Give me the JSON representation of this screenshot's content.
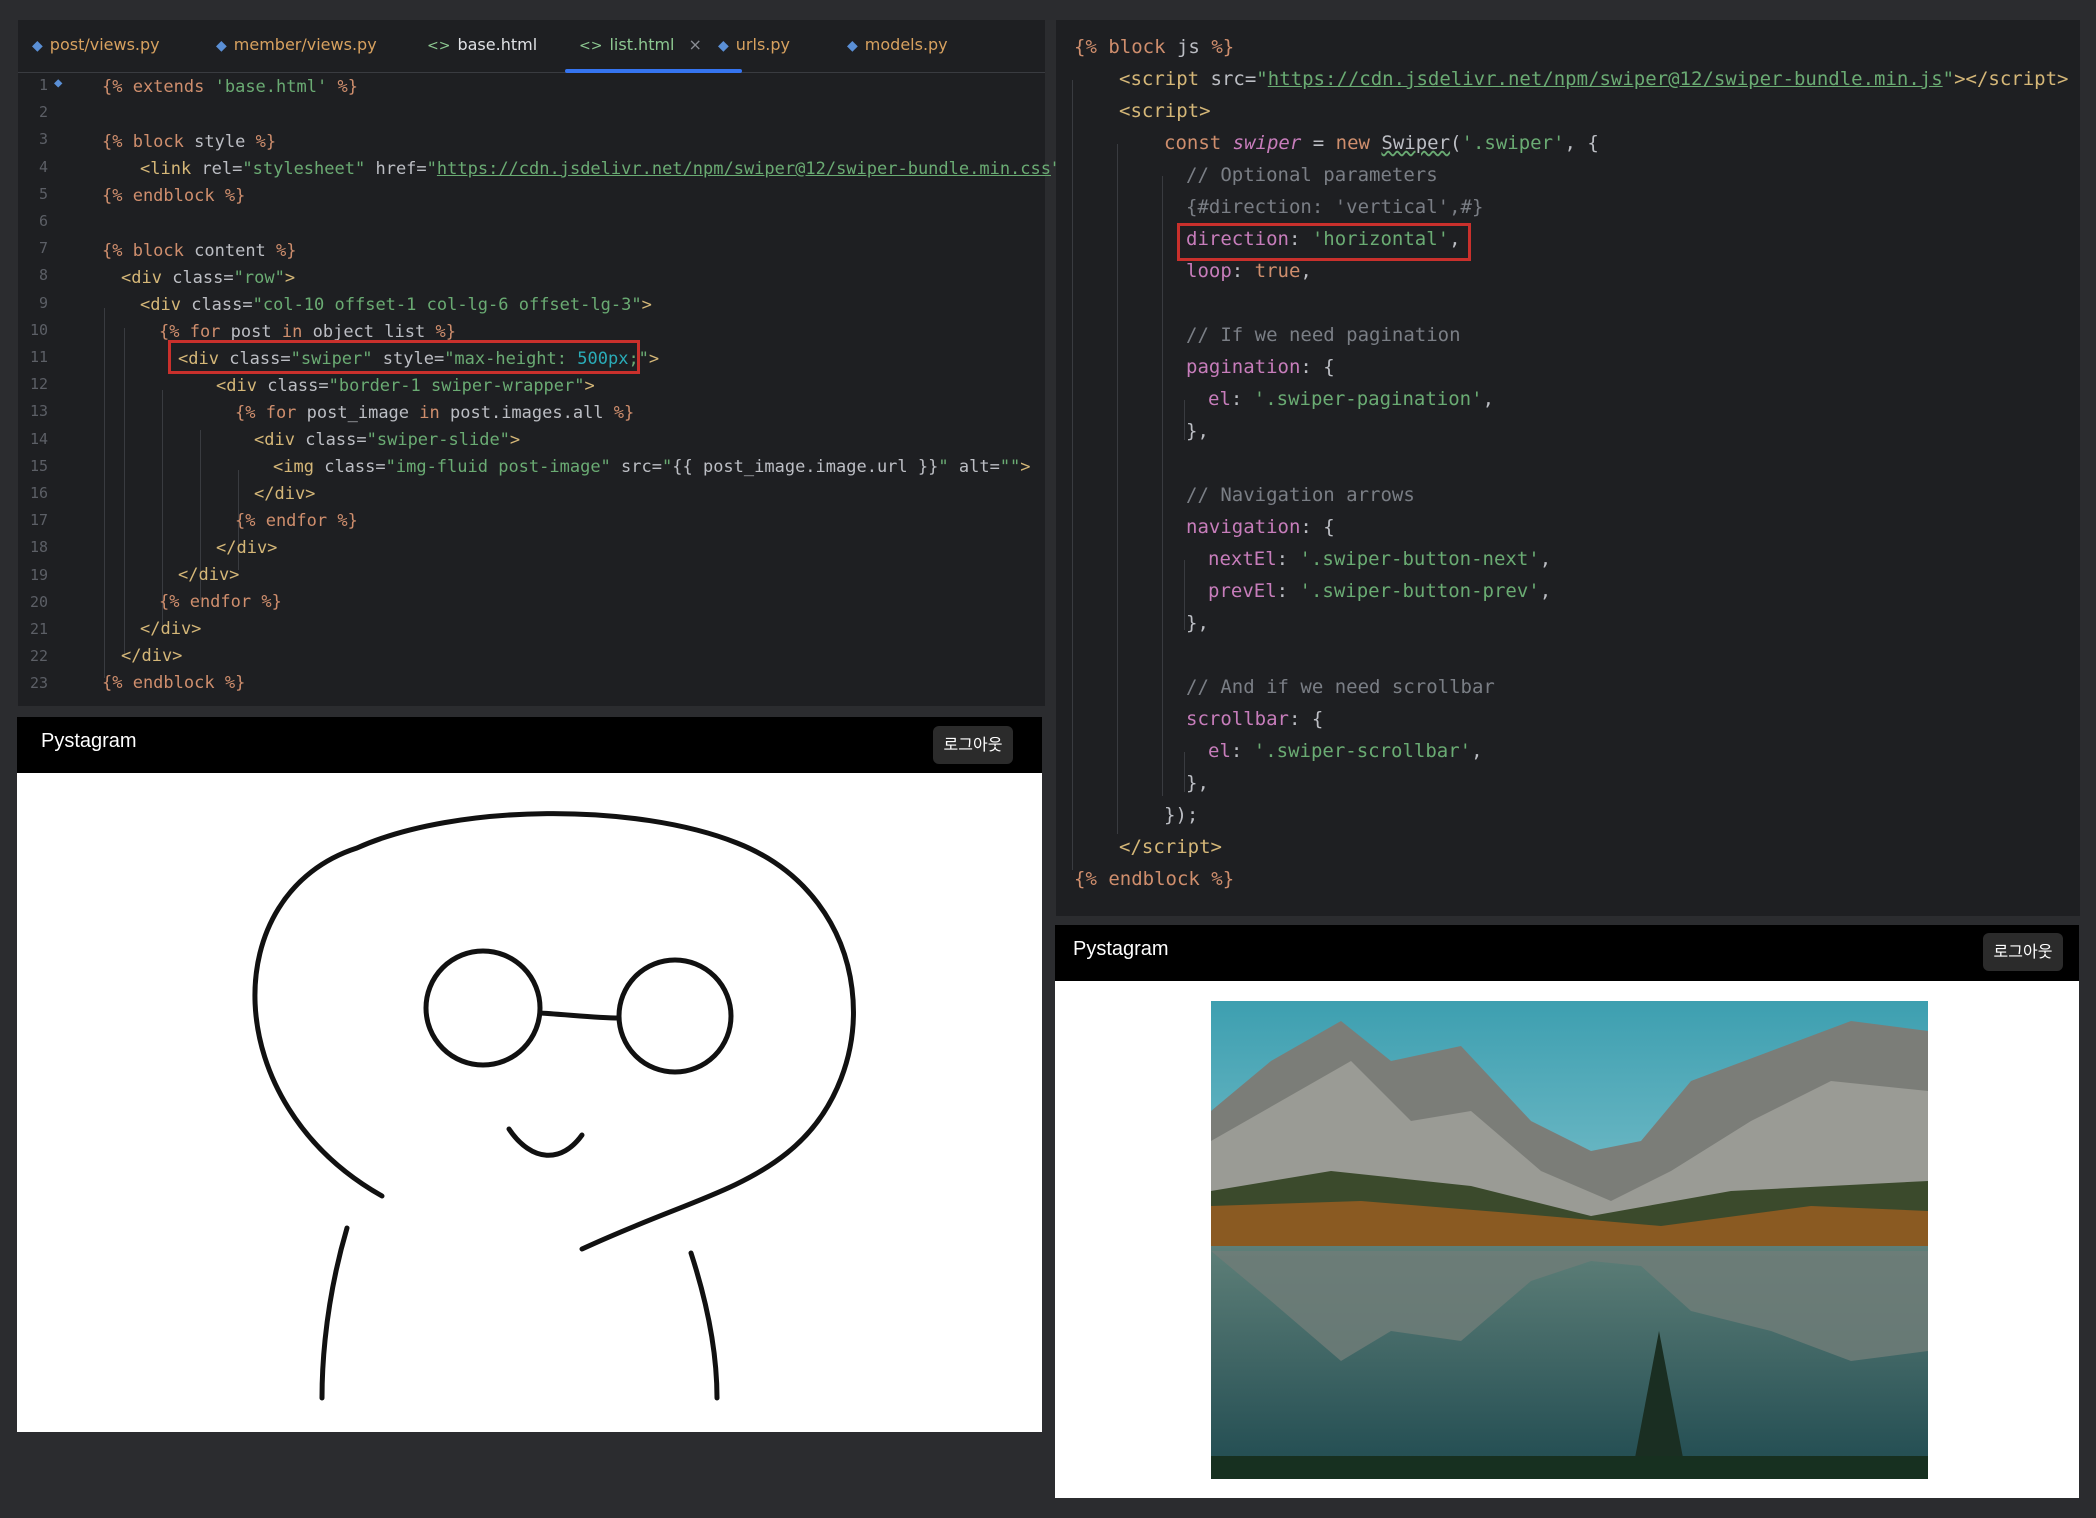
{
  "editor_left": {
    "tabs": [
      {
        "label": "post/views.py",
        "icon": "python-file-icon"
      },
      {
        "label": "member/views.py",
        "icon": "python-file-icon"
      },
      {
        "label": "base.html",
        "icon": "html-file-icon"
      },
      {
        "label": "list.html",
        "icon": "html-file-icon",
        "active": true,
        "close": "×"
      },
      {
        "label": "urls.py",
        "icon": "python-file-icon"
      },
      {
        "label": "models.py",
        "icon": "python-file-icon"
      }
    ],
    "line_numbers": [
      "1",
      "2",
      "3",
      "4",
      "5",
      "6",
      "7",
      "8",
      "9",
      "10",
      "11",
      "12",
      "13",
      "14",
      "15",
      "16",
      "17",
      "18",
      "19",
      "20",
      "21",
      "22",
      "23"
    ]
  },
  "preview_left": {
    "brand": "Pystagram",
    "logout_label": "로그아웃",
    "image": "cartoon character with glasses"
  },
  "preview_right": {
    "brand": "Pystagram",
    "logout_label": "로그아웃",
    "image": "mountain lake landscape"
  },
  "colors": {
    "accent": "#3574f0",
    "highlight": "#c9302c",
    "editor_bg": "#1e1f22"
  }
}
